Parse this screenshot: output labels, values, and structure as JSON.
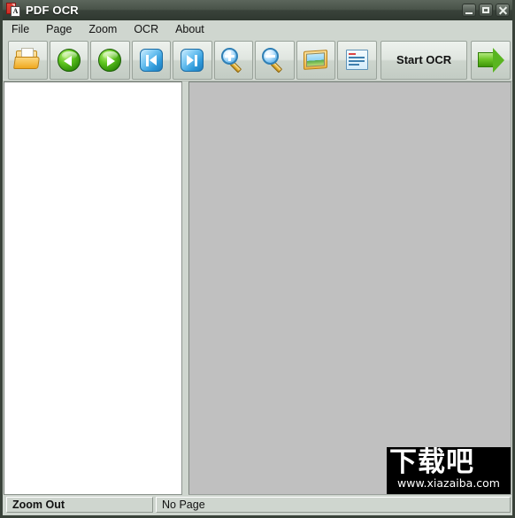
{
  "window": {
    "title": "PDF OCR",
    "app_icon": "pdf-ocr-icon",
    "icon_letter": "A",
    "controls": {
      "minimize": "minimize-button",
      "maximize": "maximize-button",
      "close": "close-button"
    }
  },
  "menu": {
    "items": [
      {
        "label": "File"
      },
      {
        "label": "Page"
      },
      {
        "label": "Zoom"
      },
      {
        "label": "OCR"
      },
      {
        "label": "About"
      }
    ]
  },
  "toolbar": {
    "buttons": [
      {
        "name": "open-file-button",
        "icon": "open-folder-icon",
        "label": ""
      },
      {
        "name": "previous-page-button",
        "icon": "green-left-arrow-icon",
        "label": ""
      },
      {
        "name": "next-page-button",
        "icon": "green-right-arrow-icon",
        "label": ""
      },
      {
        "name": "first-page-button",
        "icon": "blue-first-page-icon",
        "label": ""
      },
      {
        "name": "last-page-button",
        "icon": "blue-last-page-icon",
        "label": ""
      },
      {
        "name": "zoom-in-button",
        "icon": "magnifier-plus-icon",
        "label": ""
      },
      {
        "name": "zoom-out-button",
        "icon": "magnifier-minus-icon",
        "label": ""
      },
      {
        "name": "image-view-button",
        "icon": "picture-icon",
        "label": ""
      },
      {
        "name": "text-view-button",
        "icon": "document-report-icon",
        "label": ""
      },
      {
        "name": "start-ocr-button",
        "icon": "",
        "label": "Start OCR"
      },
      {
        "name": "export-button",
        "icon": "green-big-arrow-icon",
        "label": ""
      }
    ]
  },
  "panes": {
    "left": {
      "name": "text-output-pane",
      "content": ""
    },
    "right": {
      "name": "pdf-preview-pane",
      "content": ""
    }
  },
  "watermark": {
    "chinese": "下载吧",
    "url": "www.xiazaiba.com"
  },
  "statusbar": {
    "panel_one": "Zoom Out",
    "panel_two": "No Page"
  },
  "colors": {
    "titlebar": "#4a544a",
    "chrome": "#cfd6cf",
    "preview_bg": "#c0c0c0",
    "accent_green": "#5fc520",
    "accent_blue": "#2f9ada"
  }
}
